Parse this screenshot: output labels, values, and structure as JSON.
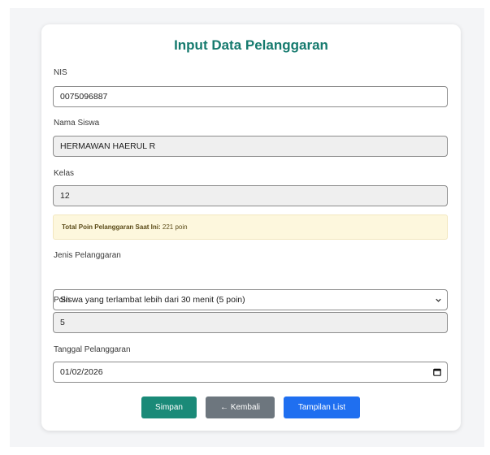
{
  "form": {
    "title": "Input Data Pelanggaran",
    "nis": {
      "label": "NIS",
      "value": "0075096887"
    },
    "nama": {
      "label": "Nama Siswa",
      "value": "HERMAWAN HAERUL R"
    },
    "kelas": {
      "label": "Kelas",
      "value": "12"
    },
    "info": {
      "label": "Total Poin Pelanggaran Saat Ini:",
      "value": "221 poin"
    },
    "jenis": {
      "label": "Jenis Pelanggaran",
      "selected": "Siswa yang terlambat lebih dari 30 menit (5 poin)"
    },
    "poin": {
      "label": "Poin",
      "value": "5"
    },
    "tanggal": {
      "label": "Tanggal Pelanggaran",
      "value": "01/02/2026"
    }
  },
  "buttons": {
    "simpan": "Simpan",
    "kembali": "← Kembali",
    "list": "Tampilan List"
  },
  "icons": {
    "select": "chevron-down-icon",
    "date": "calendar-icon"
  },
  "colors": {
    "title": "#157a6e",
    "simpan": "#1a8a78",
    "kembali": "#6d767e",
    "list": "#1f6ff0",
    "info_bg": "#fdf7dd"
  }
}
